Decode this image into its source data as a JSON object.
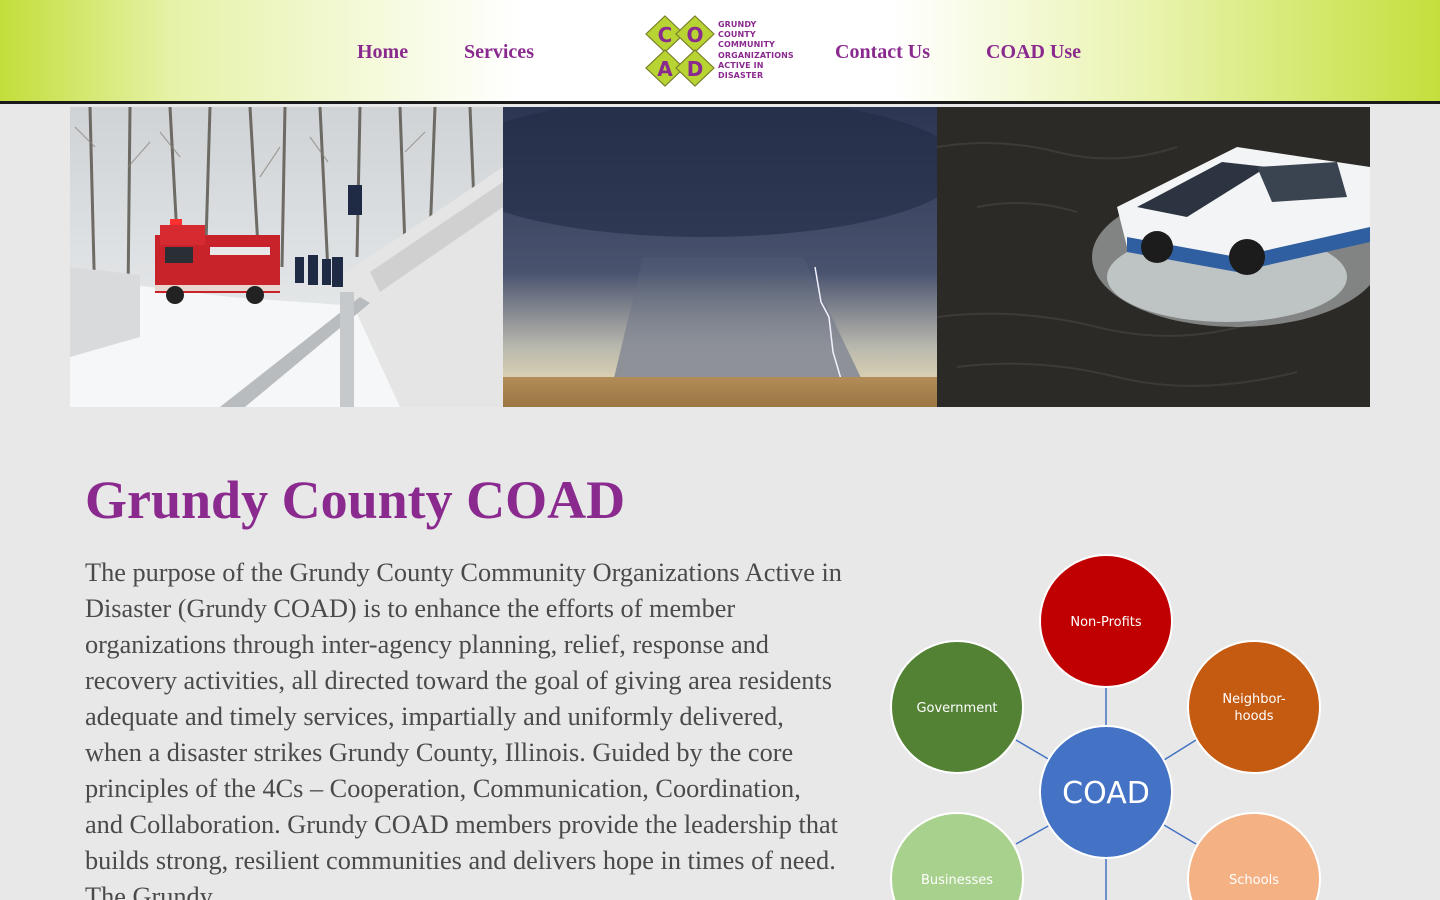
{
  "nav": {
    "home": "Home",
    "services": "Services",
    "contact": "Contact Us",
    "coad_use": "COAD Use"
  },
  "logo": {
    "letters": [
      "C",
      "O",
      "A",
      "D"
    ],
    "lines": [
      "GRUNDY",
      "COUNTY",
      "COMMUNITY",
      "ORGANIZATIONS",
      "ACTIVE IN",
      "DISASTER"
    ],
    "colors": {
      "diamond": "#b8d433",
      "letter": "#8a2a8f"
    }
  },
  "hero": {
    "panels": [
      "snowy-fire-truck-photo",
      "thunderstorm-plains-photo",
      "truck-flood-water-photo"
    ]
  },
  "main": {
    "title": "Grundy County COAD",
    "body": "The purpose of the Grundy County Community Organizations Active in Disaster (Grundy COAD) is to enhance the efforts of member organizations through inter-agency planning, relief, response and recovery activities, all directed toward the goal of giving area residents adequate and timely services, impartially and uniformly delivered, when a disaster strikes Grundy County, Illinois. Guided by the core principles of the 4Cs – Cooperation, Communication, Coordination, and Collaboration. Grundy COAD members provide the leadership that builds strong, resilient communities and delivers hope in times of need. The Grundy"
  },
  "diagram": {
    "center": "COAD",
    "nodes": {
      "non_profits": "Non-Profits",
      "government": "Government",
      "neighborhoods_1": "Neighbor-",
      "neighborhoods_2": "hoods",
      "businesses": "Businesses",
      "schools": "Schools"
    },
    "colors": {
      "center": "#4472c4",
      "non_profits": "#c00000",
      "government": "#548235",
      "neighborhoods": "#c55a11",
      "businesses": "#a9d18e",
      "schools": "#f4b183"
    }
  },
  "theme": {
    "accent": "#8a2a8f",
    "header_green": "#c2de3a",
    "background": "#e8e8e8",
    "text": "#4a4a4a"
  }
}
